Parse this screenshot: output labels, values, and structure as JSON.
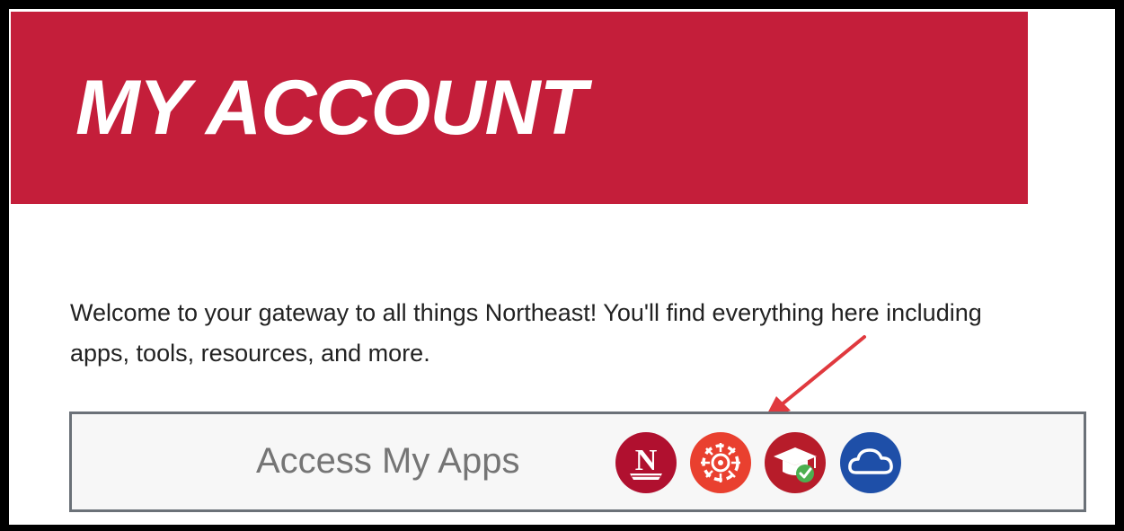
{
  "header": {
    "title": "MY ACCOUNT",
    "color": "#c41e3a"
  },
  "intro": {
    "text": "Welcome to your gateway to all things Northeast! You'll find everything here including apps, tools, resources, and more."
  },
  "apps": {
    "label": "Access My Apps",
    "items": [
      {
        "icon": "northeast-n-icon",
        "color": "#b0102f"
      },
      {
        "icon": "wheel-icon",
        "color": "#e9402f"
      },
      {
        "icon": "graduation-cap-check-icon",
        "color": "#b71c2a"
      },
      {
        "icon": "cloud-icon",
        "color": "#1e4fa8"
      }
    ]
  },
  "annotation": {
    "icon": "red-arrow-icon",
    "color": "#e0393e"
  }
}
